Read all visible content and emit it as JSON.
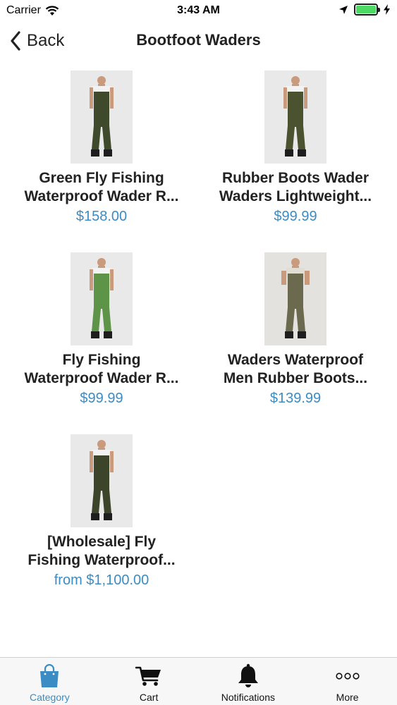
{
  "status_bar": {
    "carrier": "Carrier",
    "time": "3:43 AM"
  },
  "nav": {
    "back_label": "Back",
    "title": "Bootfoot Waders"
  },
  "products": [
    {
      "line1": "Green Fly Fishing",
      "line2": "Waterproof Wader R...",
      "price": "$158.00",
      "wader_color": "#3f4a2c"
    },
    {
      "line1": "Rubber Boots Wader",
      "line2": "Waders Lightweight...",
      "price": "$99.99",
      "wader_color": "#4a5230"
    },
    {
      "line1": "Fly Fishing",
      "line2": "Waterproof Wader R...",
      "price": "$99.99",
      "wader_color": "#5e9448"
    },
    {
      "line1": "Waders Waterproof",
      "line2": "Men Rubber Boots...",
      "price": "$139.99",
      "wader_color": "#6b6a4e"
    },
    {
      "line1": "[Wholesale] Fly",
      "line2": "Fishing Waterproof...",
      "price": "from $1,100.00",
      "wader_color": "#3c4529"
    }
  ],
  "tabs": [
    {
      "label": "Category",
      "icon": "shopping-bag-icon",
      "active": true
    },
    {
      "label": "Cart",
      "icon": "cart-icon",
      "active": false
    },
    {
      "label": "Notifications",
      "icon": "bell-icon",
      "active": false
    },
    {
      "label": "More",
      "icon": "more-icon",
      "active": false
    }
  ],
  "colors": {
    "accent": "#3b8cc4",
    "battery": "#4cd964"
  }
}
